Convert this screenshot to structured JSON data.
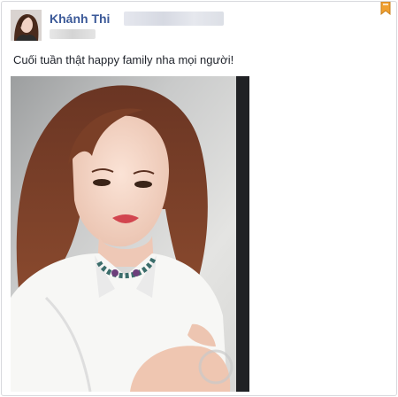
{
  "post": {
    "author_name": "Khánh Thi",
    "message": "Cuối tuần thật happy family nha mọi người!"
  },
  "icons": {
    "avatar": "profile-photo",
    "corner": "bookmark-ribbon-icon",
    "photo": "post-photo"
  },
  "colors": {
    "author_link": "#3b5998",
    "text": "#1d2129",
    "border": "#d8d9dd",
    "corner_icon": "#f0a030"
  }
}
